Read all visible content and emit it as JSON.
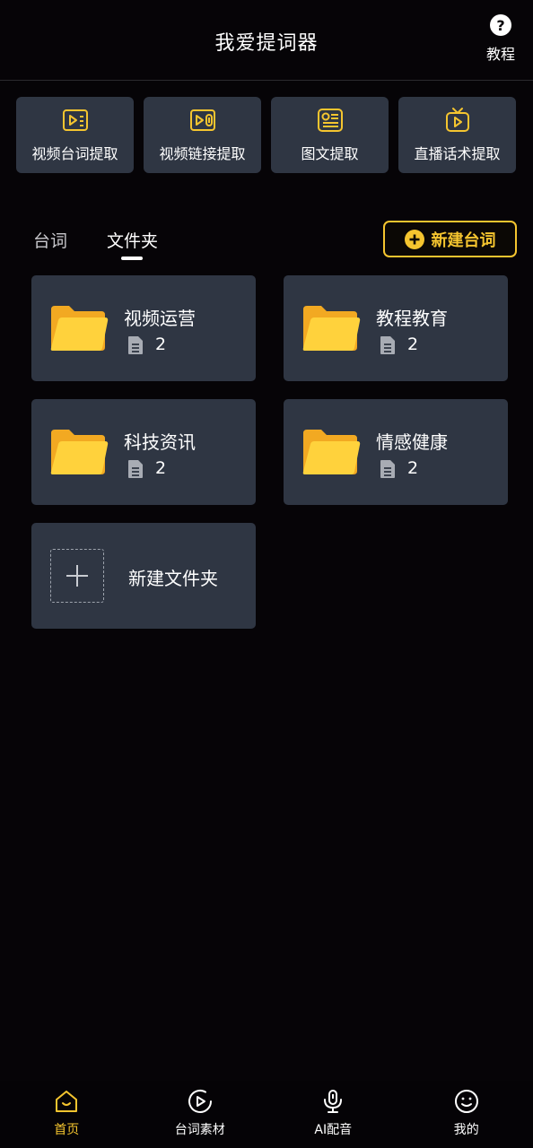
{
  "header": {
    "title": "我爱提词器",
    "help_label": "教程"
  },
  "tools": [
    {
      "label": "视频台词提取",
      "icon": "video-lines-icon"
    },
    {
      "label": "视频链接提取",
      "icon": "video-link-icon"
    },
    {
      "label": "图文提取",
      "icon": "image-text-icon"
    },
    {
      "label": "直播话术提取",
      "icon": "live-tv-icon"
    }
  ],
  "tabs": {
    "lines": "台词",
    "folders": "文件夹",
    "active": "folders"
  },
  "new_line_button": "新建台词",
  "folders": [
    {
      "name": "视频运营",
      "count": "2"
    },
    {
      "name": "教程教育",
      "count": "2"
    },
    {
      "name": "科技资讯",
      "count": "2"
    },
    {
      "name": "情感健康",
      "count": "2"
    }
  ],
  "new_folder": "新建文件夹",
  "bottom_nav": [
    {
      "label": "首页",
      "icon": "home-icon",
      "active": true
    },
    {
      "label": "台词素材",
      "icon": "play-circle-icon",
      "active": false
    },
    {
      "label": "AI配音",
      "icon": "microphone-icon",
      "active": false
    },
    {
      "label": "我的",
      "icon": "smiley-icon",
      "active": false
    }
  ],
  "colors": {
    "background": "#060407",
    "card": "#2f3643",
    "accent": "#f5c52f"
  }
}
